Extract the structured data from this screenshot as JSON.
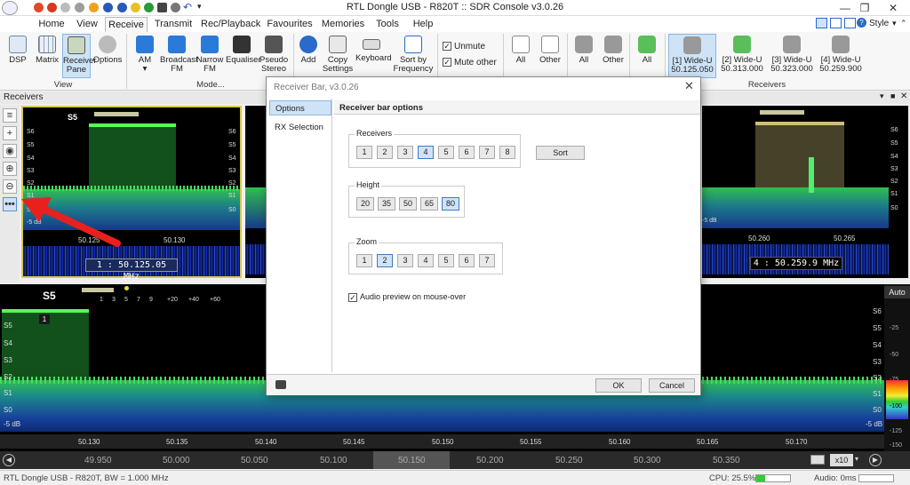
{
  "window": {
    "title": "RTL Dongle USB - R820T :: SDR Console v3.0.26",
    "style_label": "Style"
  },
  "menu_tabs": [
    "Home",
    "View",
    "Receive",
    "Transmit",
    "Rec/Playback",
    "Favourites",
    "Memories",
    "Tools",
    "Help"
  ],
  "ribbon": {
    "view_buttons": [
      "DSP",
      "Matrix",
      "Receiver Pane",
      "Options"
    ],
    "view_group": "View",
    "mode_buttons": [
      "AM",
      "Broadcast FM",
      "Narrow FM",
      "Equaliser",
      "Pseudo Stereo"
    ],
    "mode_group": "Mode...",
    "action_buttons": [
      "Add",
      "Copy Settings",
      "Keyboard",
      "Sort by Frequency"
    ],
    "unmute": "Unmute",
    "mute_other": "Mute other",
    "mute_buttons": [
      "All",
      "Other",
      "All",
      "Other",
      "All"
    ],
    "receivers": [
      {
        "label": "[1]  Wide-U",
        "freq": "50.125.050"
      },
      {
        "label": "[2]  Wide-U",
        "freq": "50.313.000"
      },
      {
        "label": "[3]  Wide-U",
        "freq": "50.323.000"
      },
      {
        "label": "[4]  Wide-U",
        "freq": "50.259.900"
      }
    ],
    "receivers_group": "Receivers"
  },
  "receivers_pane": {
    "title": "Receivers",
    "rx1": {
      "s_label": "S5",
      "scale": [
        "S6",
        "S5",
        "S4",
        "S3",
        "S2",
        "S1",
        "S0",
        "-5 dB"
      ],
      "freqs": [
        "50.125",
        "50.130"
      ],
      "vfo": "1 : 50.125.05 MHz"
    },
    "rx4": {
      "scale": [
        "S6",
        "S5",
        "S4",
        "S3",
        "S2",
        "S1",
        "S0",
        "-5 dB"
      ],
      "freqs": [
        "50.260",
        "50.265"
      ],
      "vfo": "4 : 50.259.9 MHz"
    }
  },
  "main_panel": {
    "s_label": "S5",
    "meter_scale": [
      "1",
      "3",
      "5",
      "7",
      "9",
      "+20",
      "+40",
      "+60"
    ],
    "rx_marker": "1",
    "left_scale": [
      "S5",
      "S4",
      "S3",
      "S2",
      "S1",
      "S0",
      "-5 dB"
    ],
    "right_scale": [
      "S6",
      "S5",
      "S4",
      "S3",
      "S2",
      "S1",
      "S0",
      "-5 dB"
    ],
    "freq_scale": [
      "50.130",
      "50.135",
      "50.140",
      "50.145",
      "50.150",
      "50.155",
      "50.160",
      "50.165",
      "50.170"
    ],
    "ruler": [
      "49.950",
      "50.000",
      "50.050",
      "50.100",
      "50.150",
      "50.200",
      "50.250",
      "50.300",
      "50.350"
    ],
    "zoom": "x10",
    "auto": "Auto",
    "meter_values": [
      "-25",
      "-50",
      "-75",
      "-100",
      "-125",
      "-150"
    ]
  },
  "status": {
    "device": "RTL Dongle USB - R820T, BW = 1.000 MHz",
    "cpu": "CPU: 25.5%",
    "audio": "Audio: 0ms"
  },
  "dialog": {
    "title": "Receiver Bar, v3.0.26",
    "nav": [
      "Options",
      "RX Selection"
    ],
    "header": "Receiver bar options",
    "receivers_legend": "Receivers",
    "receivers_buttons": [
      "1",
      "2",
      "3",
      "4",
      "5",
      "6",
      "7",
      "8"
    ],
    "receivers_selected": "4",
    "sort_label": "Sort",
    "height_legend": "Height",
    "height_buttons": [
      "20",
      "35",
      "50",
      "65",
      "80"
    ],
    "height_selected": "80",
    "zoom_legend": "Zoom",
    "zoom_buttons": [
      "1",
      "2",
      "3",
      "4",
      "5",
      "6",
      "7"
    ],
    "zoom_selected": "2",
    "audio_preview": "Audio preview on mouse-over",
    "ok": "OK",
    "cancel": "Cancel"
  },
  "colors": {
    "accent_blue": "#3d7bc4",
    "selection_bg": "#cfe3f7",
    "spectrum_green": "#2fbf4f",
    "waterfall_blue": "#1530a8",
    "arrow_red": "#e8211e",
    "rx_border_yellow": "#d8c850"
  }
}
